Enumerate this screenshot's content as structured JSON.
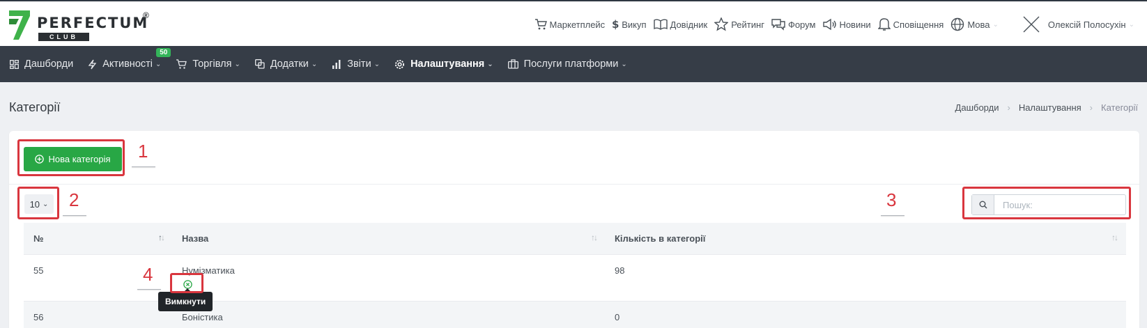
{
  "brand": {
    "name": "PERFECTUM",
    "registered": "®",
    "sub": "CLUB"
  },
  "topnav": {
    "items": [
      {
        "label": "Маркетплейс",
        "icon": "cart-icon"
      },
      {
        "label": "Викуп",
        "icon": "dollar-icon"
      },
      {
        "label": "Довідник",
        "icon": "book-icon"
      },
      {
        "label": "Рейтинг",
        "icon": "star-icon"
      },
      {
        "label": "Форум",
        "icon": "chat-icon"
      },
      {
        "label": "Новини",
        "icon": "megaphone-icon"
      },
      {
        "label": "Сповіщення",
        "icon": "bell-icon"
      },
      {
        "label": "Мова",
        "icon": "globe-icon"
      }
    ],
    "user_name": "Олексій Полосухін"
  },
  "mainnav": {
    "items": [
      {
        "label": "Дашборди"
      },
      {
        "label": "Активності",
        "badge": "50"
      },
      {
        "label": "Торгівля"
      },
      {
        "label": "Додатки"
      },
      {
        "label": "Звіти"
      },
      {
        "label": "Налаштування"
      },
      {
        "label": "Послуги платформи"
      }
    ]
  },
  "page": {
    "title": "Категорії",
    "breadcrumb": [
      "Дашборди",
      "Налаштування",
      "Категорії"
    ]
  },
  "toolbar": {
    "new_button": "Нова категорія",
    "page_length": "10",
    "search_placeholder": "Пошук:"
  },
  "table": {
    "headers": [
      "№",
      "Назва",
      "Кількість в категорії"
    ],
    "rows": [
      {
        "id": "55",
        "name": "Нумізматика",
        "count": "98"
      },
      {
        "id": "56",
        "name": "Боністика",
        "count": "0"
      }
    ]
  },
  "tooltip": "Вимкнути",
  "annotations": [
    "1",
    "2",
    "3",
    "4"
  ],
  "colors": {
    "accent_green": "#28a745",
    "nav_bg": "#363d47",
    "annotation_red": "#d9363e"
  }
}
